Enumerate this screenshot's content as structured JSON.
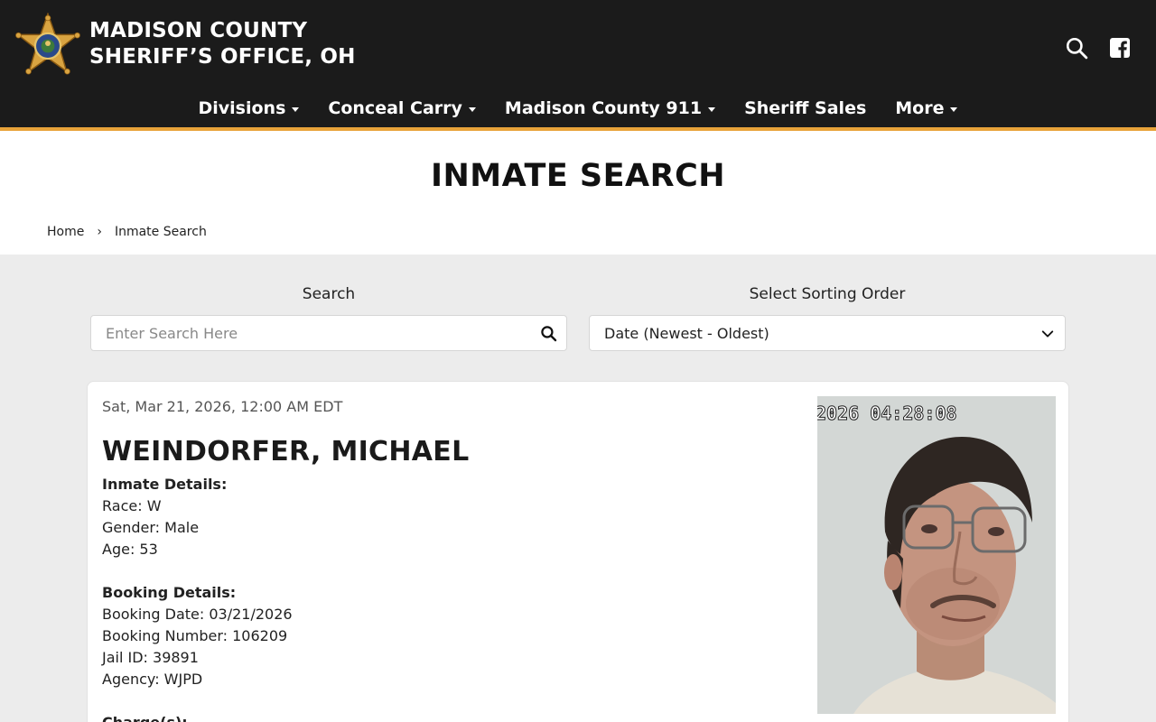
{
  "header": {
    "title_line1": "MADISON COUNTY",
    "title_line2": "SHERIFF’S OFFICE, OH",
    "colors": {
      "bg": "#1b1b1b",
      "accent": "#e8a33a",
      "star": "#d9a441"
    },
    "icons": [
      "sheriff-star-logo",
      "search-icon",
      "facebook-icon"
    ]
  },
  "nav": {
    "items": [
      {
        "label": "Divisions",
        "dropdown": true
      },
      {
        "label": "Conceal Carry",
        "dropdown": true
      },
      {
        "label": "Madison County 911",
        "dropdown": true
      },
      {
        "label": "Sheriff Sales",
        "dropdown": false
      },
      {
        "label": "More",
        "dropdown": true
      }
    ]
  },
  "page": {
    "title": "INMATE SEARCH"
  },
  "breadcrumb": {
    "home": "Home",
    "separator": "›",
    "current": "Inmate Search"
  },
  "search": {
    "label": "Search",
    "placeholder": "Enter Search Here",
    "value": ""
  },
  "sort": {
    "label": "Select Sorting Order",
    "selected": "Date (Newest - Oldest)"
  },
  "inmate": {
    "date": "Sat, Mar 21, 2026, 12:00 AM EDT",
    "name": "WEINDORFER, MICHAEL",
    "inmate_details_heading": "Inmate Details:",
    "race": "Race: W",
    "gender": "Gender: Male",
    "age": "Age: 53",
    "booking_details_heading": "Booking Details:",
    "booking_date": "Booking Date: 03/21/2026",
    "booking_number": "Booking Number: 106209",
    "jail_id": "Jail ID: 39891",
    "agency": "Agency: WJPD",
    "charges_heading": "Charge(s):",
    "photo_timestamp": "2026 04:28:08"
  }
}
